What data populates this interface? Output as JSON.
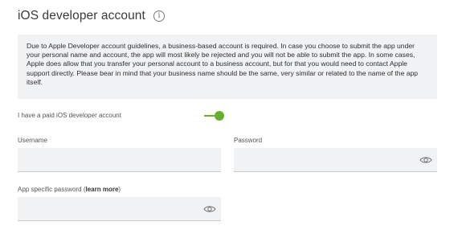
{
  "header": {
    "title": "iOS developer account",
    "info_icon": "info-icon"
  },
  "notice": {
    "text": "Due to Apple Developer account guidelines, a business-based account is required. In case you choose to submit the app under your personal name and account, the app will most likely be rejected and you will not be able to submit the app. In some cases, Apple does allow that you transfer your personal account to a business account, but for that you would need to contact Apple support directly. Please bear in mind that your business name should be the same, very similar or related to the name of the app itself."
  },
  "toggle": {
    "label": "I have a paid iOS developer account",
    "state": "on",
    "color": "#68ae32"
  },
  "fields": {
    "username": {
      "label": "Username",
      "value": ""
    },
    "password": {
      "label": "Password",
      "value": "",
      "icon": "eye-icon"
    },
    "app_password": {
      "label_prefix": "App specific password (",
      "link_text": "learn more",
      "label_suffix": ")",
      "value": "",
      "icon": "eye-icon"
    }
  }
}
